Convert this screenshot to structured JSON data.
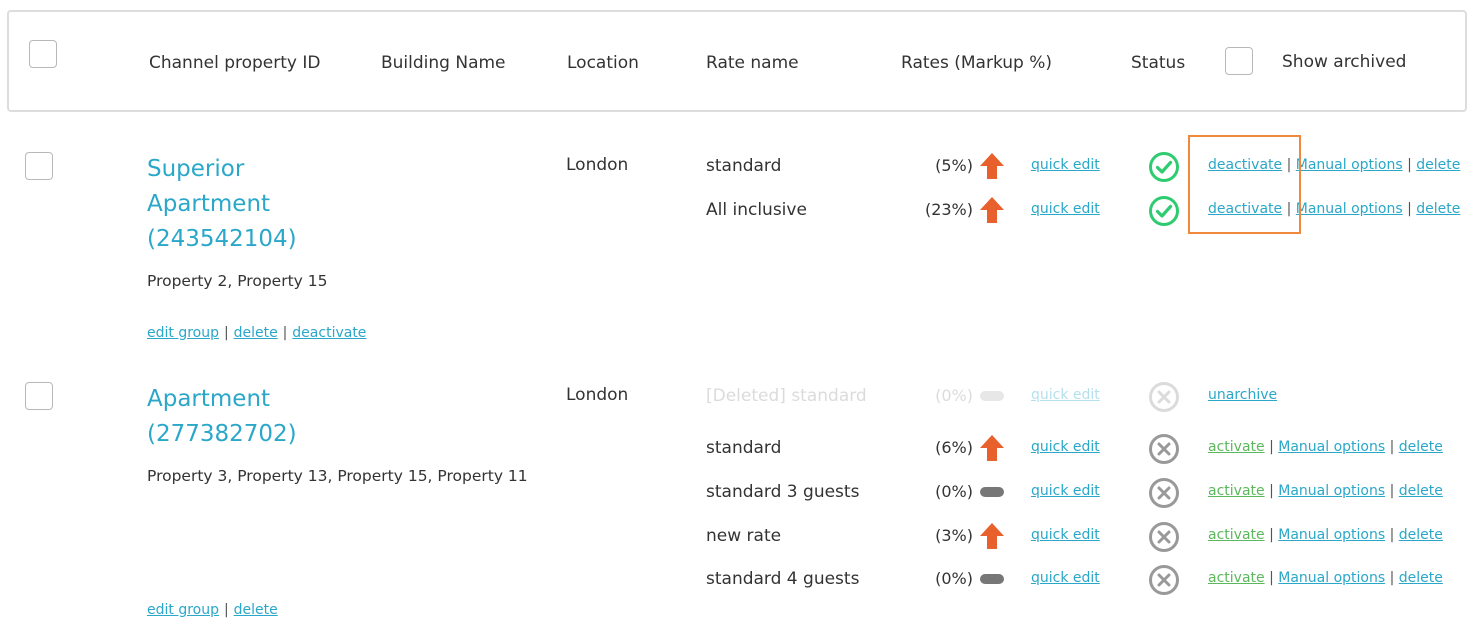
{
  "header": {
    "col_id": "Channel property ID",
    "col_building": "Building Name",
    "col_location": "Location",
    "col_rate": "Rate name",
    "col_rates": "Rates (Markup %)",
    "col_status": "Status",
    "show_archived": "Show archived"
  },
  "groups": [
    {
      "title_line1": "Superior",
      "title_line2": "Apartment",
      "title_line3": "(243542104)",
      "properties": "Property 2, Property 15",
      "location": "London",
      "links": {
        "edit_group": "edit group",
        "delete": "delete",
        "deactivate": "deactivate"
      },
      "rates": [
        {
          "name": "standard",
          "markup": "(5%)",
          "trend": "up",
          "quick_edit": "quick edit",
          "status": "active",
          "action": "deactivate",
          "manual": "Manual options",
          "delete": "delete"
        },
        {
          "name": "All inclusive",
          "markup": "(23%)",
          "trend": "up",
          "quick_edit": "quick edit",
          "status": "active",
          "action": "deactivate",
          "manual": "Manual options",
          "delete": "delete"
        }
      ]
    },
    {
      "title_line1": "Apartment",
      "title_line2": "(277382702)",
      "properties": "Property 3, Property 13, Property 15, Property 11",
      "location": "London",
      "links": {
        "edit_group": "edit group",
        "delete": "delete"
      },
      "rates": [
        {
          "name": "[Deleted] standard",
          "markup": "(0%)",
          "trend": "flat",
          "quick_edit": "quick edit",
          "status": "deleted",
          "action": "unarchive"
        },
        {
          "name": "standard",
          "markup": "(6%)",
          "trend": "up",
          "quick_edit": "quick edit",
          "status": "inactive",
          "action": "activate",
          "manual": "Manual options",
          "delete": "delete"
        },
        {
          "name": "standard 3 guests",
          "markup": "(0%)",
          "trend": "flat",
          "quick_edit": "quick edit",
          "status": "inactive",
          "action": "activate",
          "manual": "Manual options",
          "delete": "delete"
        },
        {
          "name": "new rate",
          "markup": "(3%)",
          "trend": "up",
          "quick_edit": "quick edit",
          "status": "inactive",
          "action": "activate",
          "manual": "Manual options",
          "delete": "delete"
        },
        {
          "name": "standard 4 guests",
          "markup": "(0%)",
          "trend": "flat",
          "quick_edit": "quick edit",
          "status": "inactive",
          "action": "activate",
          "manual": "Manual options",
          "delete": "delete"
        }
      ]
    }
  ],
  "colors": {
    "link": "#2aa7c9",
    "active": "#2ecc71",
    "arrow": "#e8602c",
    "flat": "#777777",
    "activate": "#5cb85c",
    "highlight": "#f0883e"
  },
  "icons": {
    "up": "arrow-up-icon",
    "flat": "flat-pill-icon",
    "active": "check-circle-icon",
    "inactive": "x-circle-icon"
  }
}
